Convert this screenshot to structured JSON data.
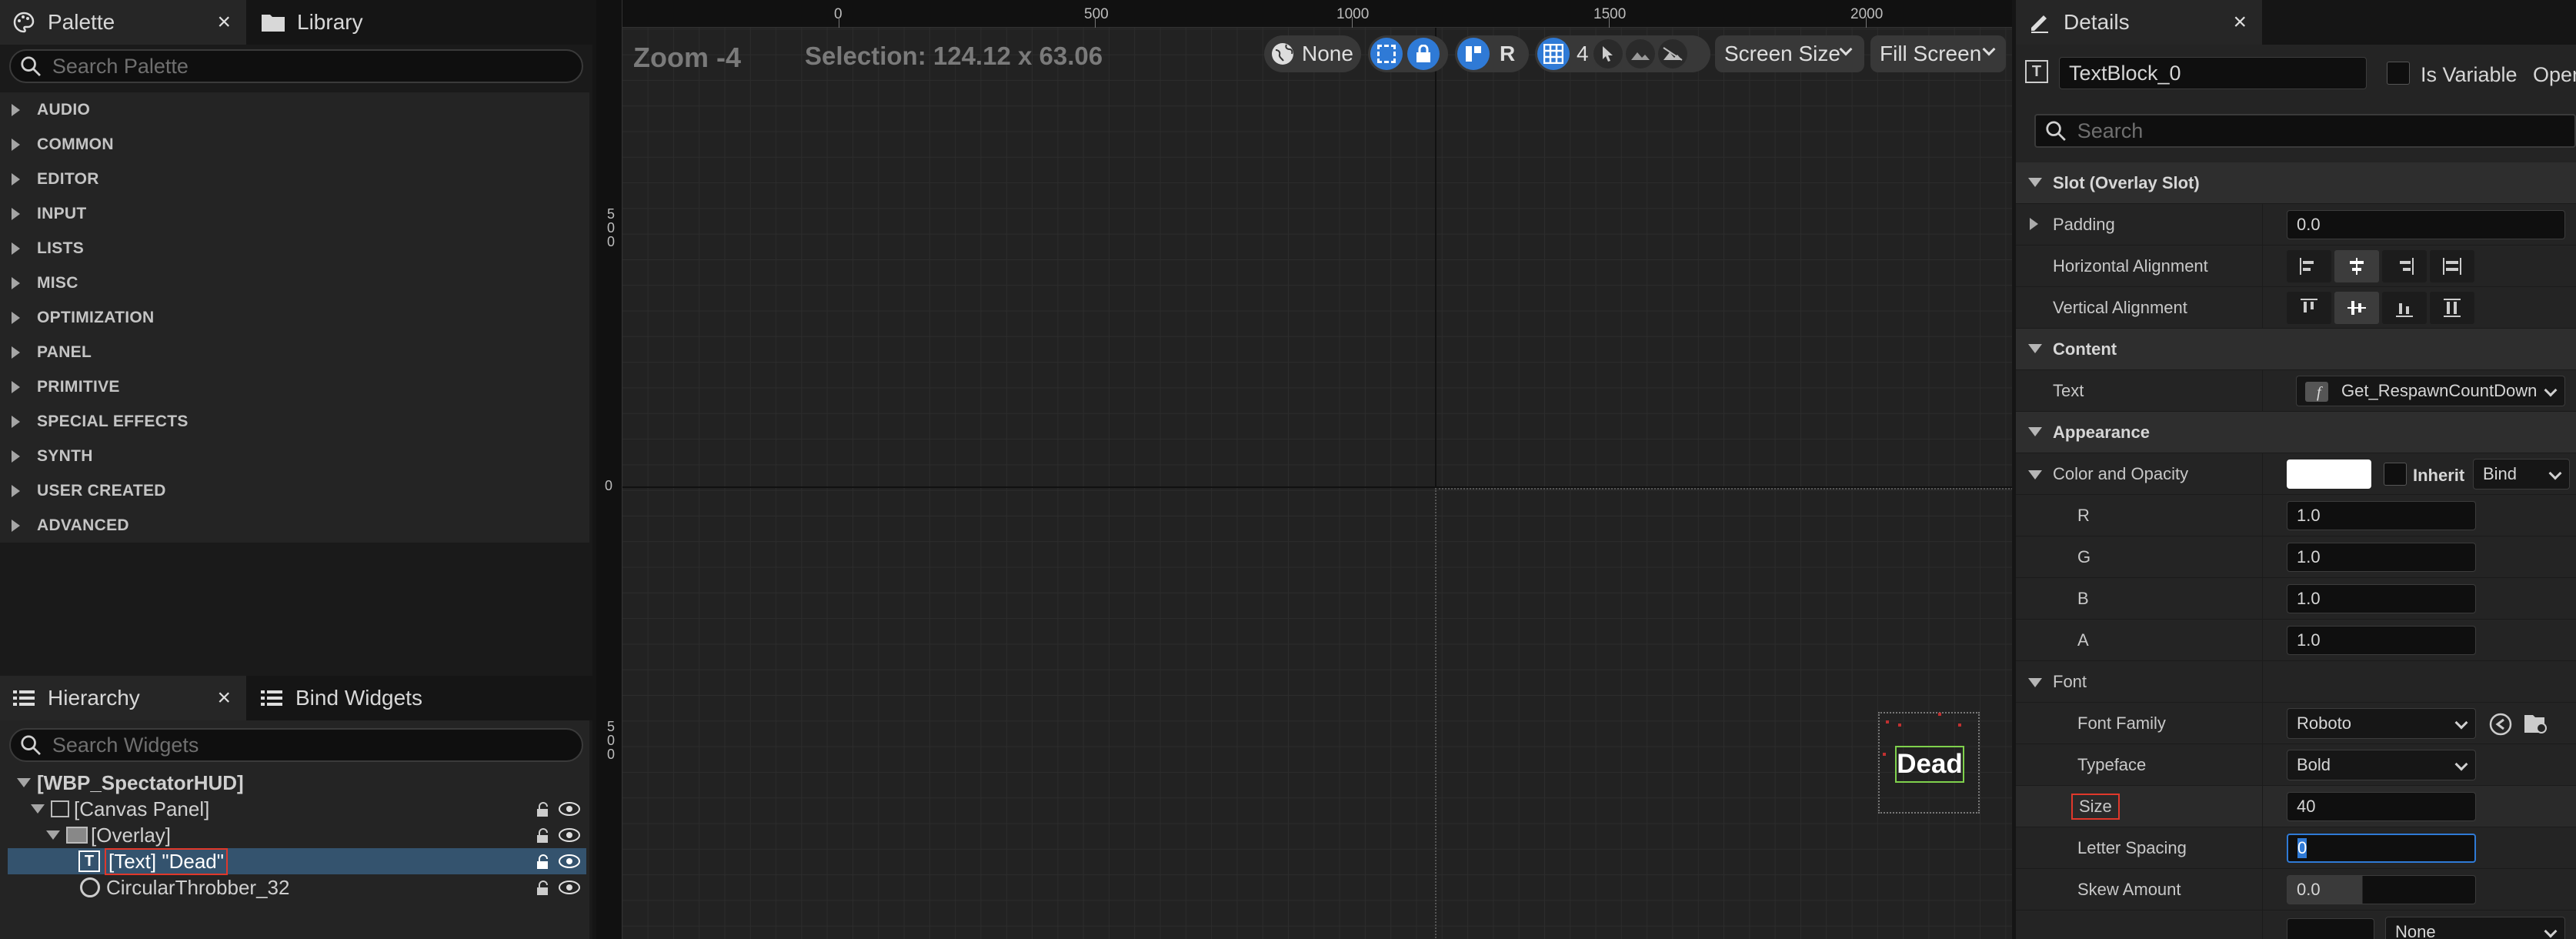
{
  "palette": {
    "tab_label": "Palette",
    "library_tab_label": "Library",
    "close_symbol": "×",
    "search_placeholder": "Search Palette",
    "categories": [
      "AUDIO",
      "COMMON",
      "EDITOR",
      "INPUT",
      "LISTS",
      "MISC",
      "OPTIMIZATION",
      "PANEL",
      "PRIMITIVE",
      "SPECIAL EFFECTS",
      "SYNTH",
      "USER CREATED",
      "ADVANCED"
    ]
  },
  "hierarchy": {
    "tab_label": "Hierarchy",
    "bind_widgets_label": "Bind Widgets",
    "close_symbol": "×",
    "search_placeholder": "Search Widgets",
    "items": [
      {
        "label": "[WBP_SpectatorHUD]"
      },
      {
        "label": "[Canvas Panel]"
      },
      {
        "label": "[Overlay]"
      },
      {
        "label": "[Text] \"Dead\""
      },
      {
        "label": "CircularThrobber_32"
      }
    ]
  },
  "viewport": {
    "zoom_label": "Zoom -4",
    "selection_label": "Selection: 124.12 x 63.06",
    "ruler_top": [
      "0",
      "500",
      "1000",
      "1500",
      "2000"
    ],
    "ruler_left": [
      "500",
      "0",
      "500"
    ],
    "toolbar": {
      "localization_label": "None",
      "resize_mode": "R",
      "grid_snap_value": "4",
      "screen_size_label": "Screen Size",
      "fill_label": "Fill Screen"
    },
    "preview_text": "Dead"
  },
  "details": {
    "tab_label": "Details",
    "close_symbol": "×",
    "widget_name": "TextBlock_0",
    "is_variable_label": "Is Variable",
    "open_label": "Open",
    "search_placeholder": "Search",
    "slot_section": "Slot (Overlay Slot)",
    "padding_label": "Padding",
    "padding_value": "0.0",
    "halign_label": "Horizontal Alignment",
    "valign_label": "Vertical Alignment",
    "content_section": "Content",
    "text_label": "Text",
    "text_binding": "Get_RespawnCountDown",
    "appearance_section": "Appearance",
    "color_label": "Color and Opacity",
    "inherit_label": "Inherit",
    "bind_label": "Bind",
    "color_swatch": "#ffffff",
    "r_label": "R",
    "r_value": "1.0",
    "g_label": "G",
    "g_value": "1.0",
    "b_label": "B",
    "b_value": "1.0",
    "a_label": "A",
    "a_value": "1.0",
    "font_section": "Font",
    "font_family_label": "Font Family",
    "font_family_value": "Roboto",
    "typeface_label": "Typeface",
    "typeface_value": "Bold",
    "size_label": "Size",
    "size_value": "40",
    "letter_spacing_label": "Letter Spacing",
    "letter_spacing_value": "0",
    "skew_label": "Skew Amount",
    "skew_value": "0.0",
    "bottom_dropdown": "None"
  },
  "colors": {
    "accent_blue": "#2f7ad6",
    "selection_row": "#34536e",
    "highlight_red": "#e0382b",
    "selected_outline": "#7fd14c"
  }
}
